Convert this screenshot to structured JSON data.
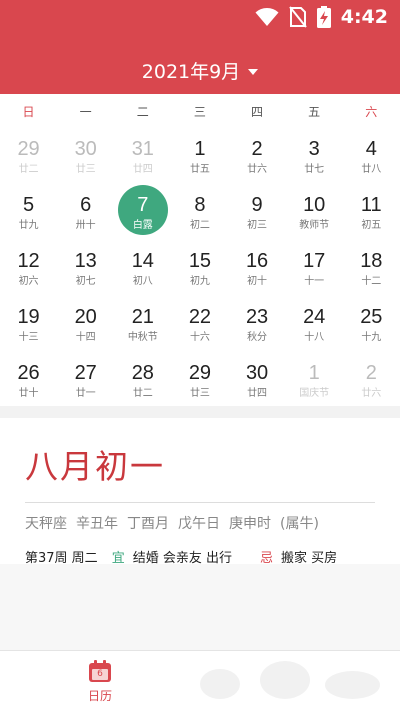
{
  "status": {
    "time": "4:42"
  },
  "header": {
    "month_title": "2021年9月"
  },
  "weekdays": [
    "日",
    "一",
    "二",
    "三",
    "四",
    "五",
    "六"
  ],
  "days": [
    {
      "d": "29",
      "s": "廿二",
      "muted": true
    },
    {
      "d": "30",
      "s": "廿三",
      "muted": true
    },
    {
      "d": "31",
      "s": "廿四",
      "muted": true
    },
    {
      "d": "1",
      "s": "廿五"
    },
    {
      "d": "2",
      "s": "廿六"
    },
    {
      "d": "3",
      "s": "廿七"
    },
    {
      "d": "4",
      "s": "廿八"
    },
    {
      "d": "5",
      "s": "廿九"
    },
    {
      "d": "6",
      "s": "卅十"
    },
    {
      "d": "7",
      "s": "白露",
      "selected": true
    },
    {
      "d": "8",
      "s": "初二"
    },
    {
      "d": "9",
      "s": "初三"
    },
    {
      "d": "10",
      "s": "教师节"
    },
    {
      "d": "11",
      "s": "初五"
    },
    {
      "d": "12",
      "s": "初六"
    },
    {
      "d": "13",
      "s": "初七"
    },
    {
      "d": "14",
      "s": "初八"
    },
    {
      "d": "15",
      "s": "初九"
    },
    {
      "d": "16",
      "s": "初十"
    },
    {
      "d": "17",
      "s": "十一"
    },
    {
      "d": "18",
      "s": "十二"
    },
    {
      "d": "19",
      "s": "十三"
    },
    {
      "d": "20",
      "s": "十四"
    },
    {
      "d": "21",
      "s": "中秋节"
    },
    {
      "d": "22",
      "s": "十六"
    },
    {
      "d": "23",
      "s": "秋分"
    },
    {
      "d": "24",
      "s": "十八"
    },
    {
      "d": "25",
      "s": "十九"
    },
    {
      "d": "26",
      "s": "廿十"
    },
    {
      "d": "27",
      "s": "廿一"
    },
    {
      "d": "28",
      "s": "廿二"
    },
    {
      "d": "29",
      "s": "廿三"
    },
    {
      "d": "30",
      "s": "廿四"
    },
    {
      "d": "1",
      "s": "国庆节",
      "muted": true
    },
    {
      "d": "2",
      "s": "廿六",
      "muted": true
    }
  ],
  "detail": {
    "lunar_date": "八月初一",
    "ganzhi": [
      "天秤座",
      "辛丑年",
      "丁酉月",
      "戊午日",
      "庚申时",
      "(属牛)"
    ],
    "week_info": "第37周 周二",
    "yi_label": "宜",
    "yi_items": "结婚 会亲友 出行",
    "ji_label": "忌",
    "ji_items": "搬家 买房"
  },
  "tabbar": {
    "calendar_label": "日历",
    "calendar_icon_day": "6"
  },
  "colors": {
    "header": "#d9474e",
    "selected": "#3fa87f",
    "accent": "#c9383d"
  }
}
